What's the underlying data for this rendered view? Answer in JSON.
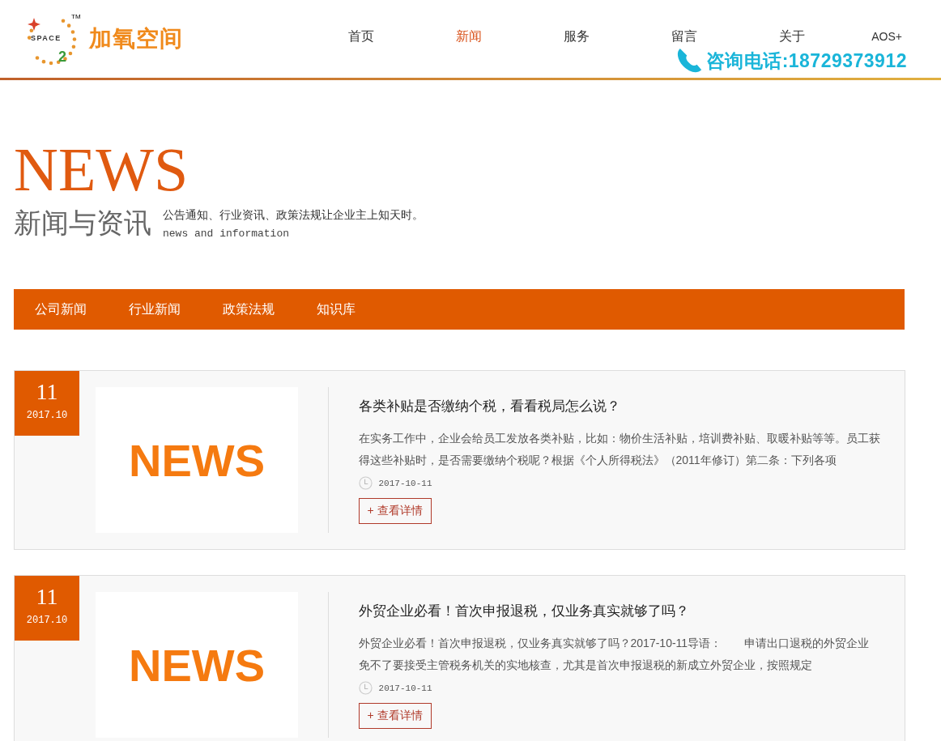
{
  "header": {
    "logo": {
      "mark_text": "SPACE",
      "mark_number": "2",
      "trademark": "TM",
      "name": "加氧空间"
    },
    "nav": [
      {
        "label": "首页",
        "selected": false
      },
      {
        "label": "新闻",
        "selected": true
      },
      {
        "label": "服务",
        "selected": false
      },
      {
        "label": "留言",
        "selected": false
      },
      {
        "label": "关于",
        "selected": false
      },
      {
        "label": "AOS+",
        "selected": false
      }
    ],
    "hotline": "咨询电话:18729373912"
  },
  "hero": {
    "title": "NEWS",
    "subtitle": "新闻与资讯",
    "description": "公告通知、行业资讯、政策法规让企业主上知天时。",
    "description_en": "news and information"
  },
  "categories": [
    "公司新闻",
    "行业新闻",
    "政策法规",
    "知识库"
  ],
  "articles": [
    {
      "day": "11",
      "month": "2017.10",
      "thumbnail_text": "NEWS",
      "title": "各类补贴是否缴纳个税，看看税局怎么说？",
      "summary": "在实务工作中，企业会给员工发放各类补贴，比如：物价生活补贴，培训费补贴、取暖补贴等等。员工获得这些补贴时，是否需要缴纳个税呢？根据《个人所得税法》（2011年修订）第二条：下列各项",
      "date": "2017-10-11",
      "button": "+ 查看详情"
    },
    {
      "day": "11",
      "month": "2017.10",
      "thumbnail_text": "NEWS",
      "title": "外贸企业必看！首次申报退税，仅业务真实就够了吗？",
      "summary": "外贸企业必看！首次申报退税，仅业务真实就够了吗？2017-10-11导语：　　申请出口退税的外贸企业免不了要接受主管税务机关的实地核查，尤其是首次申报退税的新成立外贸企业，按照规定",
      "date": "2017-10-11",
      "button": "+ 查看详情"
    }
  ]
}
